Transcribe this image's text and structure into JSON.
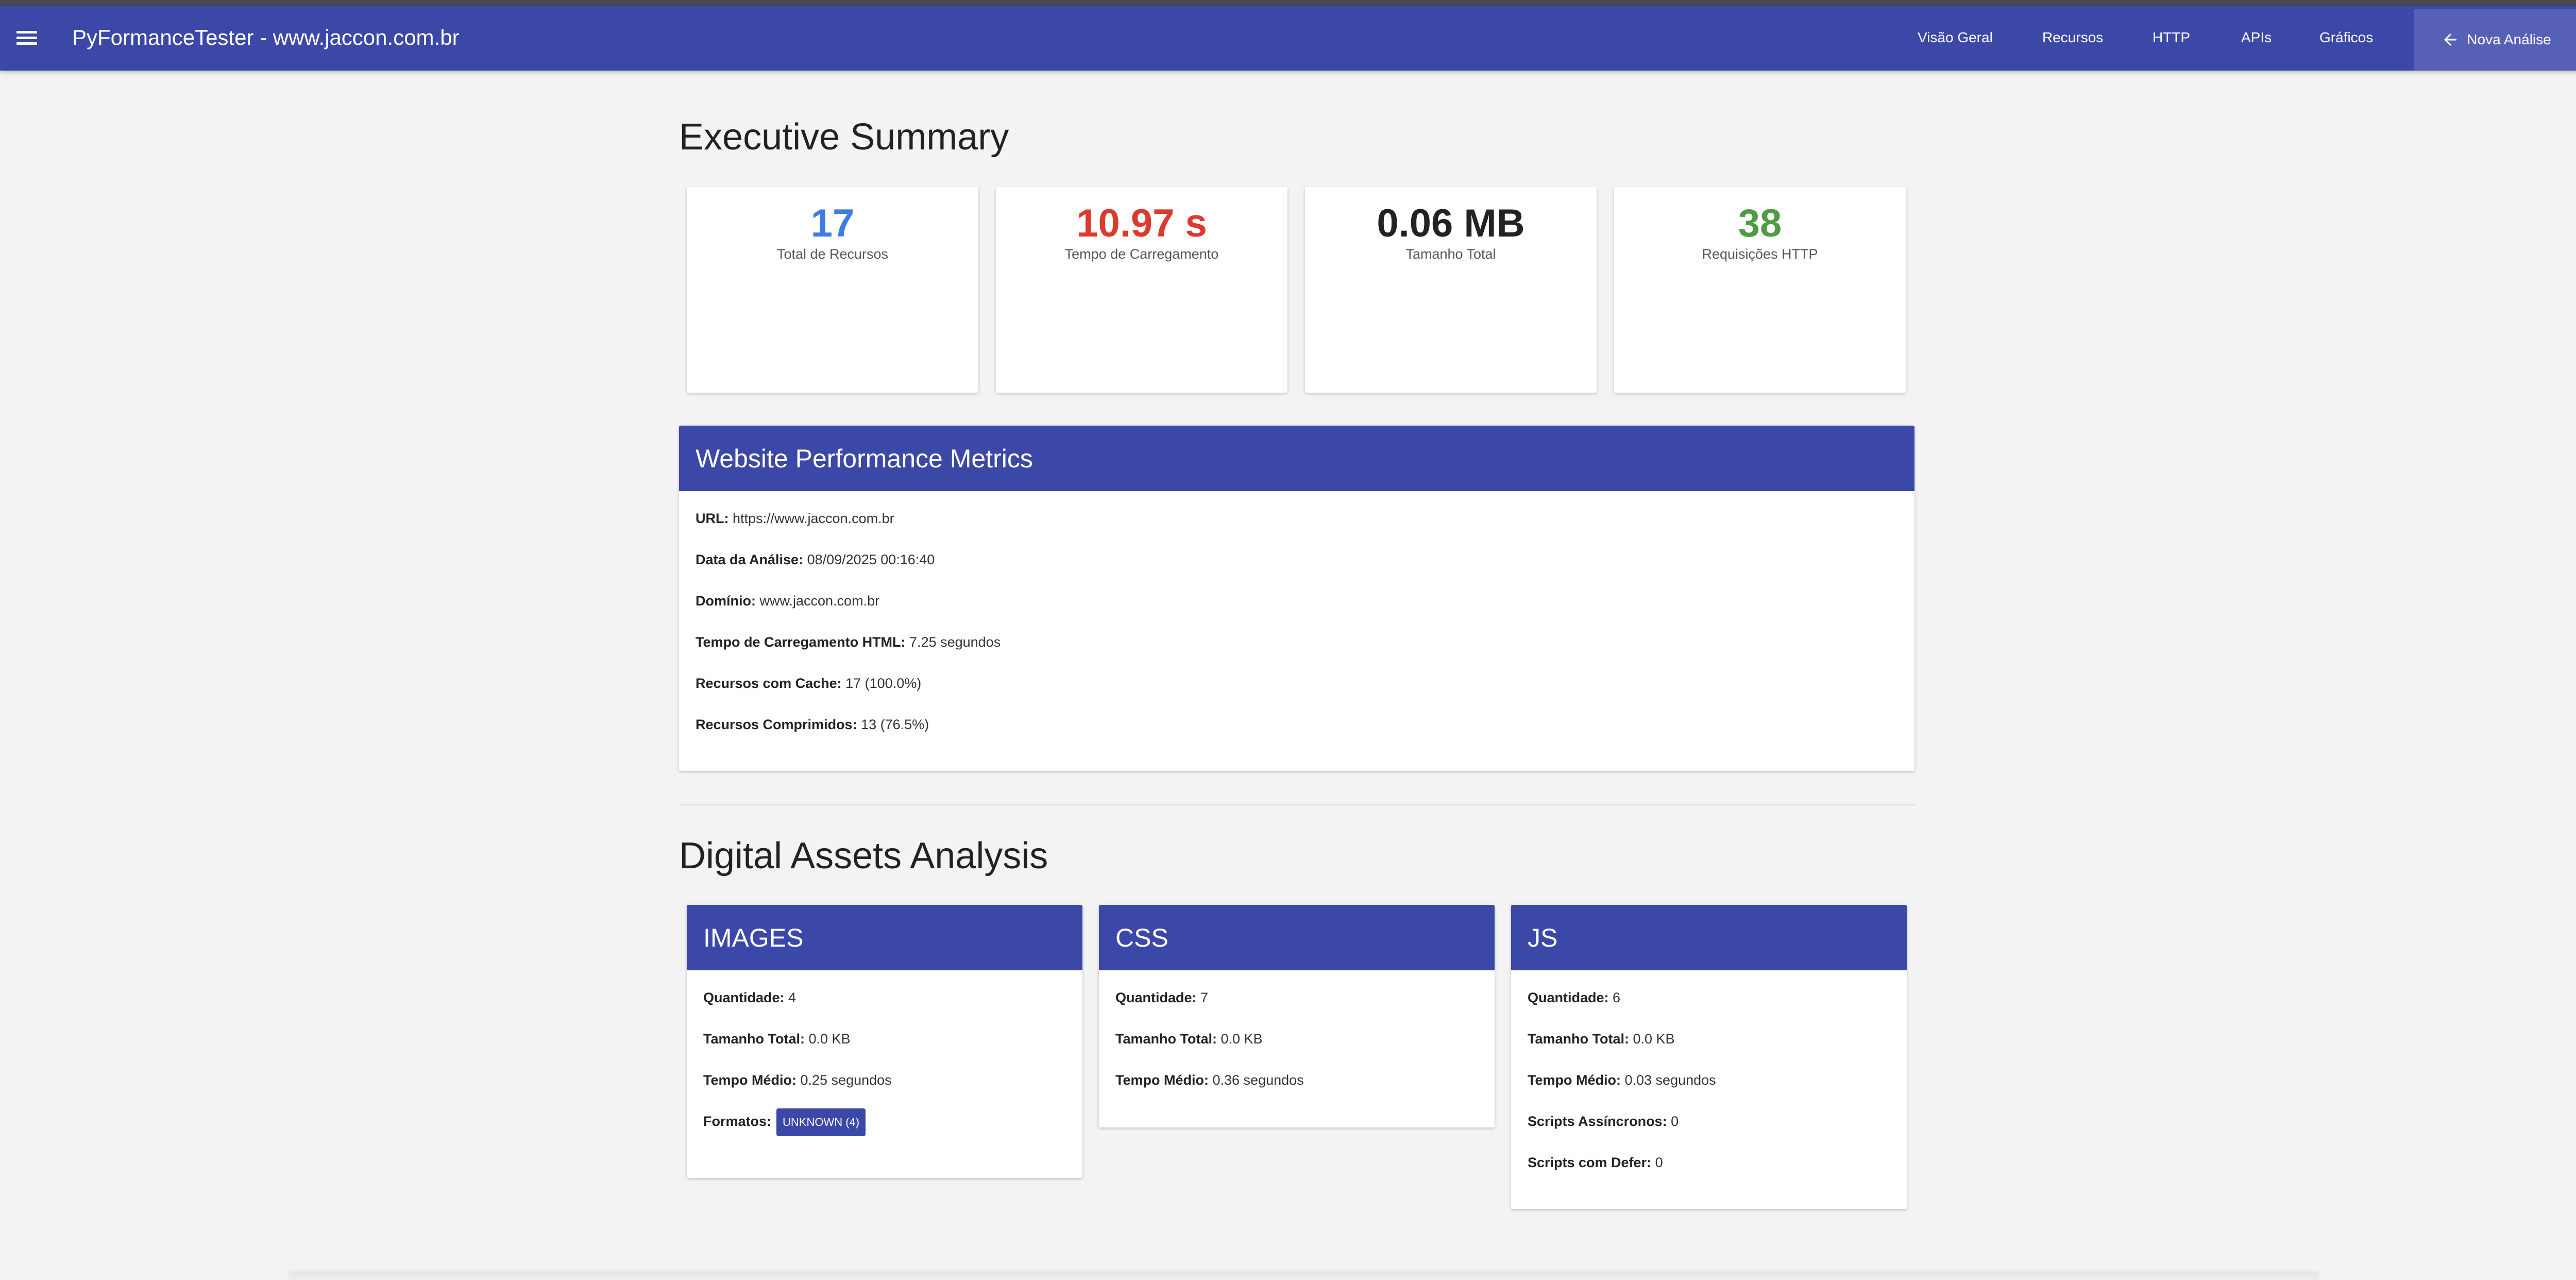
{
  "navbar": {
    "title": "PyFormanceTester - www.jaccon.com.br",
    "links": [
      "Visão Geral",
      "Recursos",
      "HTTP",
      "APIs",
      "Gráficos"
    ],
    "action_label": "Nova Análise",
    "color": "#3b48a8"
  },
  "summary": {
    "title": "Executive Summary",
    "cards": [
      {
        "value": "17",
        "label": "Total de Recursos",
        "color": "#3d7de0"
      },
      {
        "value": "10.97 s",
        "label": "Tempo de Carregamento",
        "color": "#db3a2f"
      },
      {
        "value": "0.06 MB",
        "label": "Tamanho Total",
        "color": "#222222"
      },
      {
        "value": "38",
        "label": "Requisições HTTP",
        "color": "#4f9c45"
      }
    ]
  },
  "metrics": {
    "title": "Website Performance Metrics",
    "rows": [
      {
        "label": "URL:",
        "value": "https://www.jaccon.com.br"
      },
      {
        "label": "Data da Análise:",
        "value": "08/09/2025 00:16:40"
      },
      {
        "label": "Domínio:",
        "value": "www.jaccon.com.br"
      },
      {
        "label": "Tempo de Carregamento HTML:",
        "value": "7.25 segundos"
      },
      {
        "label": "Recursos com Cache:",
        "value": "17 (100.0%)"
      },
      {
        "label": "Recursos Comprimidos:",
        "value": "13 (76.5%)"
      }
    ]
  },
  "assets": {
    "title": "Digital Assets Analysis",
    "images": {
      "title": "IMAGES",
      "rows": [
        {
          "label": "Quantidade:",
          "value": "4"
        },
        {
          "label": "Tamanho Total:",
          "value": "0.0 KB"
        },
        {
          "label": "Tempo Médio:",
          "value": "0.25 segundos"
        }
      ],
      "formats_label": "Formatos:",
      "format_chip": "UNKNOWN (4)"
    },
    "css": {
      "title": "CSS",
      "rows": [
        {
          "label": "Quantidade:",
          "value": "7"
        },
        {
          "label": "Tamanho Total:",
          "value": "0.0 KB"
        },
        {
          "label": "Tempo Médio:",
          "value": "0.36 segundos"
        }
      ]
    },
    "js": {
      "title": "JS",
      "rows": [
        {
          "label": "Quantidade:",
          "value": "6"
        },
        {
          "label": "Tamanho Total:",
          "value": "0.0 KB"
        },
        {
          "label": "Tempo Médio:",
          "value": "0.03 segundos"
        },
        {
          "label": "Scripts Assíncronos:",
          "value": "0"
        },
        {
          "label": "Scripts com Defer:",
          "value": "0"
        }
      ]
    }
  }
}
